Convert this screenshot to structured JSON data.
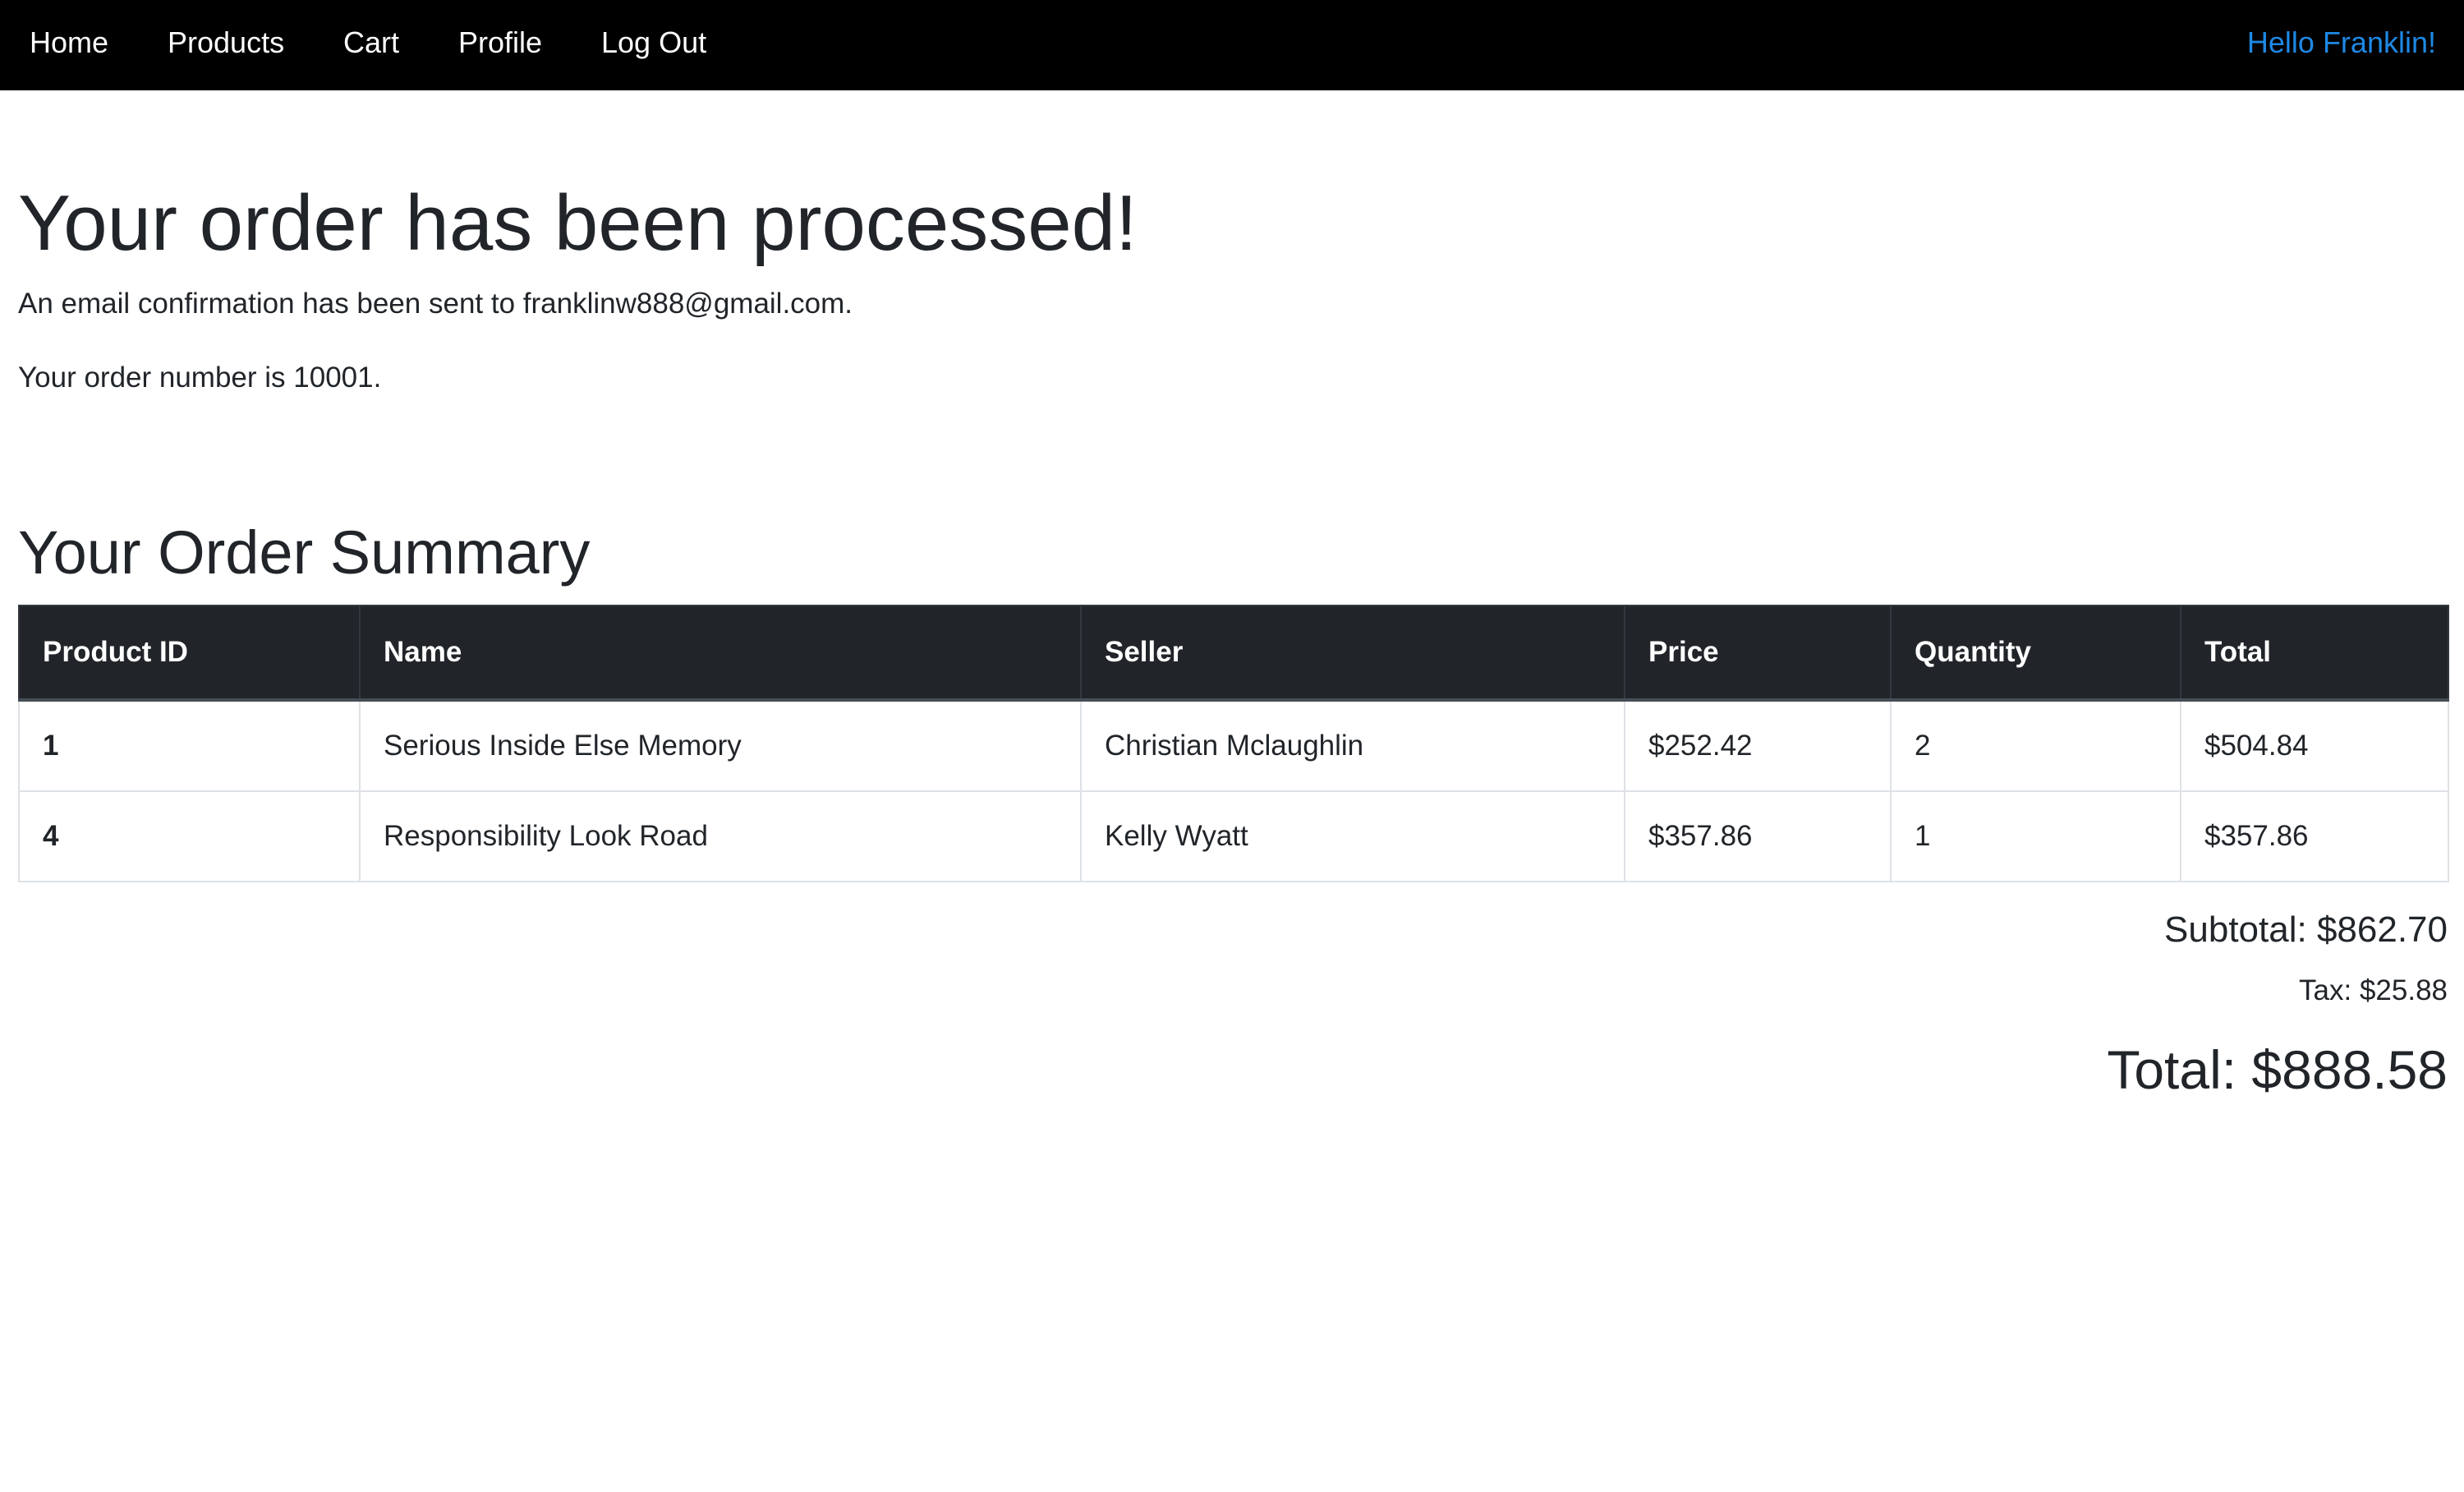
{
  "nav": {
    "home": "Home",
    "products": "Products",
    "cart": "Cart",
    "profile": "Profile",
    "logout": "Log Out",
    "greeting": "Hello Franklin!"
  },
  "confirmation": {
    "title": "Your order has been processed!",
    "email_message": "An email confirmation has been sent to franklinw888@gmail.com.",
    "order_number_message": "Your order number is 10001."
  },
  "summary": {
    "title": "Your Order Summary",
    "columns": [
      "Product ID",
      "Name",
      "Seller",
      "Price",
      "Quantity",
      "Total"
    ],
    "rows": [
      {
        "id": "1",
        "name": "Serious Inside Else Memory",
        "seller": "Christian Mclaughlin",
        "price": "$252.42",
        "quantity": "2",
        "total": "$504.84"
      },
      {
        "id": "4",
        "name": "Responsibility Look Road",
        "seller": "Kelly Wyatt",
        "price": "$357.86",
        "quantity": "1",
        "total": "$357.86"
      }
    ],
    "subtotal": "Subtotal: $862.70",
    "tax": "Tax: $25.88",
    "total": "Total: $888.58"
  },
  "colors": {
    "navbar_bg": "#000000",
    "greeting": "#1e88e5",
    "table_header_bg": "#212529"
  }
}
